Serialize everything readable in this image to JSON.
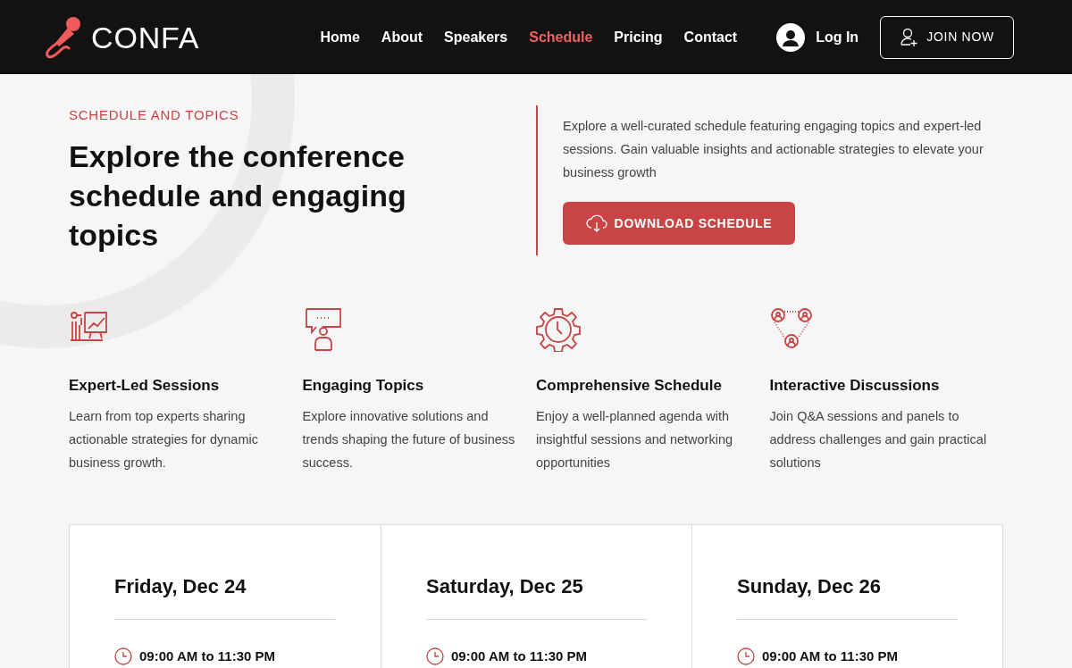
{
  "header": {
    "logo": "CONFA",
    "nav": [
      {
        "label": "Home",
        "selected": false
      },
      {
        "label": "About",
        "selected": false
      },
      {
        "label": "Speakers",
        "selected": false
      },
      {
        "label": "Schedule",
        "selected": true
      },
      {
        "label": "Pricing",
        "selected": false
      },
      {
        "label": "Contact",
        "selected": false
      }
    ],
    "login": "Log In",
    "join": "JOIN NOW"
  },
  "hero": {
    "eyebrow": "SCHEDULE AND TOPICS",
    "title": "Explore the conference schedule and engaging topics",
    "description": "Explore a well-curated schedule featuring engaging topics and expert-led sessions. Gain valuable insights and actionable strategies to elevate your business growth",
    "button": "DOWNLOAD SCHEDULE"
  },
  "features": [
    {
      "kind": "presentation",
      "title": "Expert-Led Sessions",
      "text": "Learn from top experts sharing actionable strategies for dynamic business growth."
    },
    {
      "kind": "speaker",
      "title": "Engaging Topics",
      "text": "Explore innovative solutions and trends shaping the future of business success."
    },
    {
      "kind": "gear-clock",
      "title": "Comprehensive Schedule",
      "text": "Enjoy a well-planned agenda with insightful sessions and networking opportunities"
    },
    {
      "kind": "network",
      "title": "Interactive Discussions",
      "text": "Join Q&A sessions and panels to address challenges and gain practical solutions"
    }
  ],
  "days": [
    {
      "title": "Friday, Dec 24",
      "time": "09:00 AM to 11:30 PM"
    },
    {
      "title": "Saturday, Dec 25",
      "time": "09:00 AM to 11:30 PM"
    },
    {
      "title": "Sunday, Dec 26",
      "time": "09:00 AM to 11:30 PM"
    }
  ]
}
